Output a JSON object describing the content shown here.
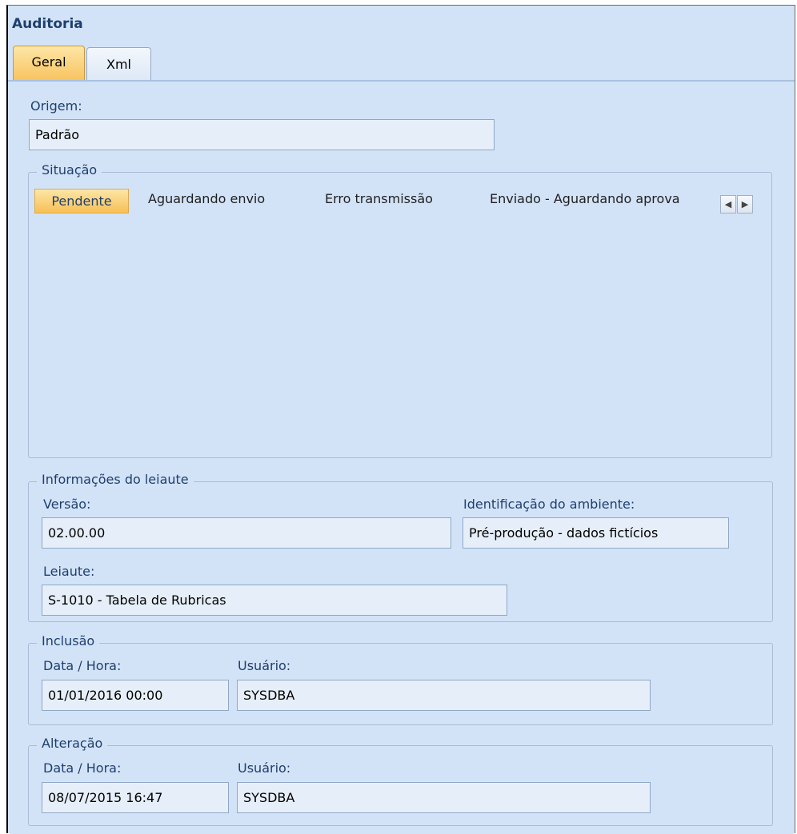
{
  "window": {
    "title": "Auditoria"
  },
  "tabs": [
    {
      "label": "Geral"
    },
    {
      "label": "Xml"
    }
  ],
  "origem": {
    "label": "Origem:",
    "value": "Padrão"
  },
  "situacao": {
    "legend": "Situação",
    "items": [
      {
        "label": "Pendente"
      },
      {
        "label": "Aguardando envio"
      },
      {
        "label": "Erro transmissão"
      },
      {
        "label": "Enviado - Aguardando aprova"
      }
    ],
    "nav": {
      "prev": "◀",
      "next": "▶"
    }
  },
  "leiaute": {
    "legend": "Informações do leiaute",
    "versao_label": "Versão:",
    "versao_value": "02.00.00",
    "ambiente_label": "Identificação do ambiente:",
    "ambiente_value": "Pré-produção - dados fictícios",
    "leiaute_label": "Leiaute:",
    "leiaute_value": "S-1010 - Tabela de Rubricas"
  },
  "inclusao": {
    "legend": "Inclusão",
    "datahora_label": "Data / Hora:",
    "datahora_value": "01/01/2016  00:00",
    "usuario_label": "Usuário:",
    "usuario_value": "SYSDBA"
  },
  "alteracao": {
    "legend": "Alteração",
    "datahora_label": "Data / Hora:",
    "datahora_value": "08/07/2015  16:47",
    "usuario_label": "Usuário:",
    "usuario_value": "SYSDBA"
  }
}
